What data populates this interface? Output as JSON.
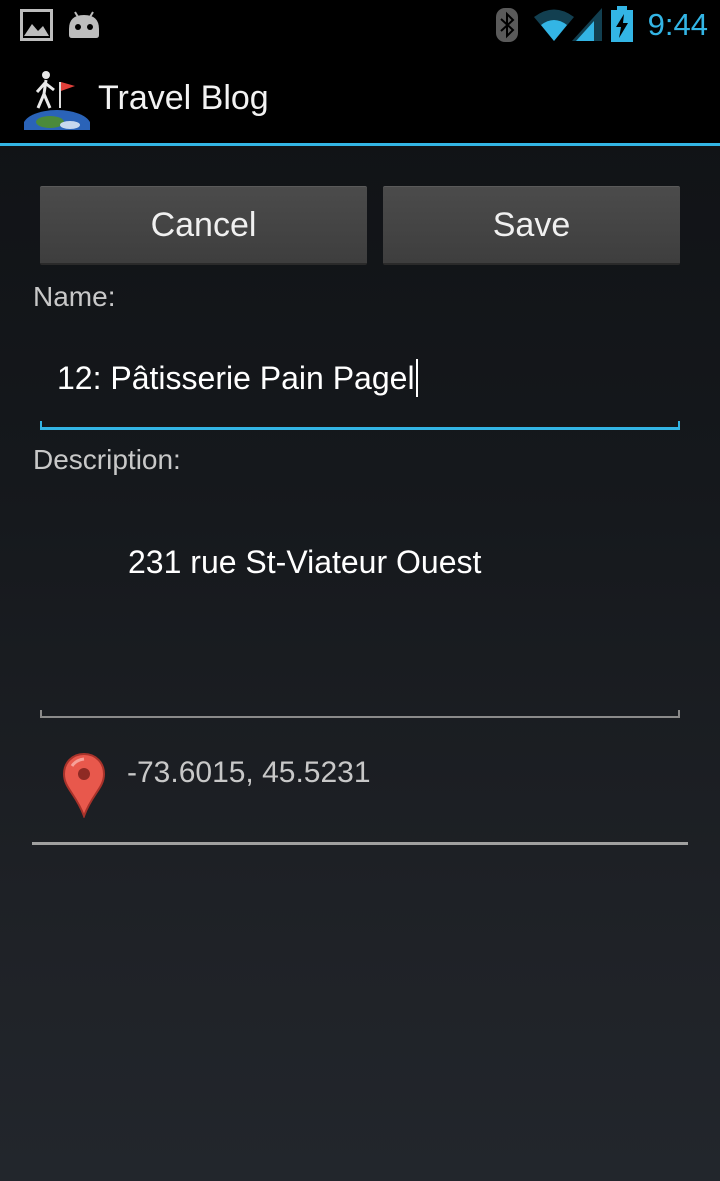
{
  "status_bar": {
    "time": "9:44",
    "left_icons": [
      "image-icon",
      "android-icon"
    ],
    "right_icons": [
      "bluetooth-icon",
      "wifi-icon",
      "signal-icon",
      "battery-charging-icon"
    ],
    "accent_color": "#33b5e5"
  },
  "action_bar": {
    "title": "Travel Blog",
    "app_icon": "hiker-globe-icon"
  },
  "buttons": {
    "cancel_label": "Cancel",
    "save_label": "Save"
  },
  "form": {
    "name_label": "Name:",
    "name_value": "12: Pâtisserie Pain Pagel",
    "description_label": "Description:",
    "description_value": "231 rue St-Viateur Ouest"
  },
  "location": {
    "icon": "map-pin-icon",
    "coordinates": "-73.6015, 45.5231"
  }
}
